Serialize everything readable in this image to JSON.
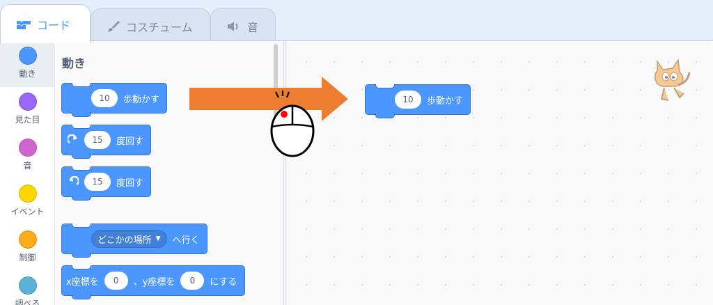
{
  "tabs": [
    {
      "label": "コード",
      "icon": "code-icon"
    },
    {
      "label": "コスチューム",
      "icon": "brush-icon"
    },
    {
      "label": "音",
      "icon": "speaker-icon"
    }
  ],
  "categories": [
    {
      "label": "動き",
      "color": "#4c97ff"
    },
    {
      "label": "見た目",
      "color": "#9966ff"
    },
    {
      "label": "音",
      "color": "#cf63cf"
    },
    {
      "label": "イベント",
      "color": "#ffd500"
    },
    {
      "label": "制御",
      "color": "#ffab19"
    },
    {
      "label": "調べる",
      "color": "#5cb1d6"
    }
  ],
  "palette": {
    "title": "動き",
    "move_block": {
      "value": "10",
      "text": "歩動かす"
    },
    "turn_right_block": {
      "value": "15",
      "text": "度回す",
      "icon": "turn-right-icon"
    },
    "turn_left_block": {
      "value": "15",
      "text": "度回す",
      "icon": "turn-left-icon"
    },
    "goto_block": {
      "dropdown": "どこかの場所",
      "text": "へ行く"
    },
    "gotoxy_block": {
      "prefix": "x座標を",
      "x_value": "0",
      "mid": "、y座標を",
      "y_value": "0",
      "suffix": "にする"
    }
  },
  "workspace": {
    "move_block": {
      "value": "10",
      "text": "歩動かす"
    }
  },
  "annotation": {
    "arrow_color": "#ed7d31",
    "mouse_button_color": "#ff0000"
  }
}
